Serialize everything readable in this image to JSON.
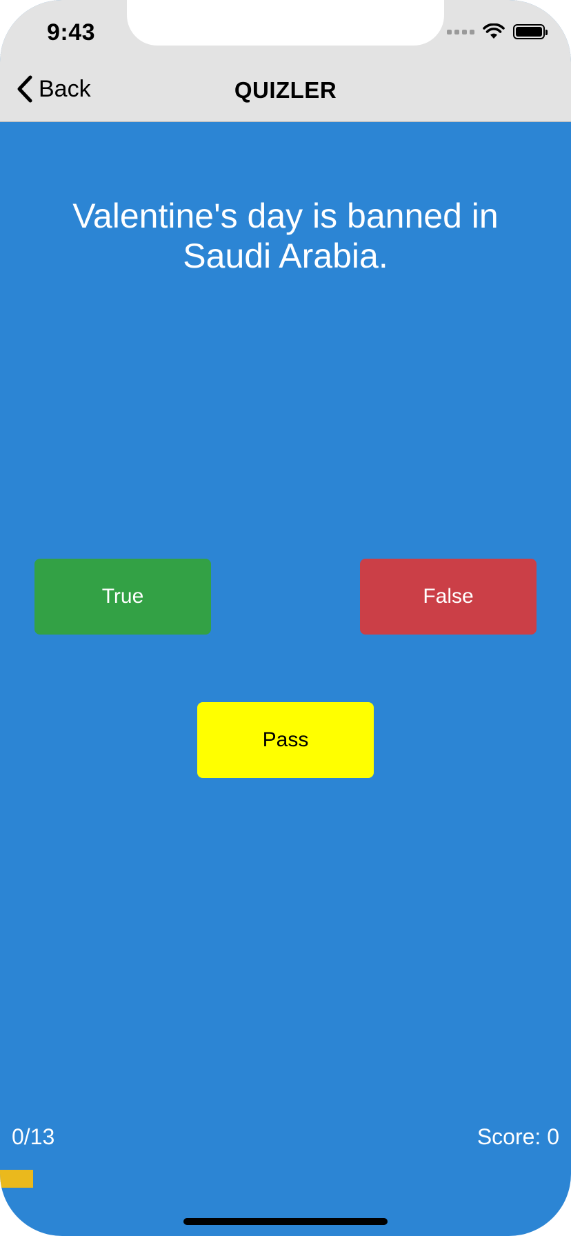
{
  "status_bar": {
    "time": "9:43"
  },
  "nav": {
    "back_label": "Back",
    "title": "QUIZLER"
  },
  "question": {
    "text": "Valentine's day is banned in Saudi Arabia."
  },
  "answers": {
    "true_label": "True",
    "false_label": "False",
    "pass_label": "Pass"
  },
  "footer": {
    "progress_text": "0/13",
    "score_text": "Score: 0",
    "progress_fraction": 0.058
  },
  "colors": {
    "background": "#2c85d4",
    "true_button": "#33a145",
    "false_button": "#cb3f47",
    "pass_button": "#ffff00",
    "progress_bar": "#eab91d",
    "nav_bar": "#e3e3e3"
  },
  "icons": {
    "back": "chevron-left-icon",
    "wifi": "wifi-icon",
    "battery": "battery-icon",
    "signal": "cellular-signal-icon"
  }
}
